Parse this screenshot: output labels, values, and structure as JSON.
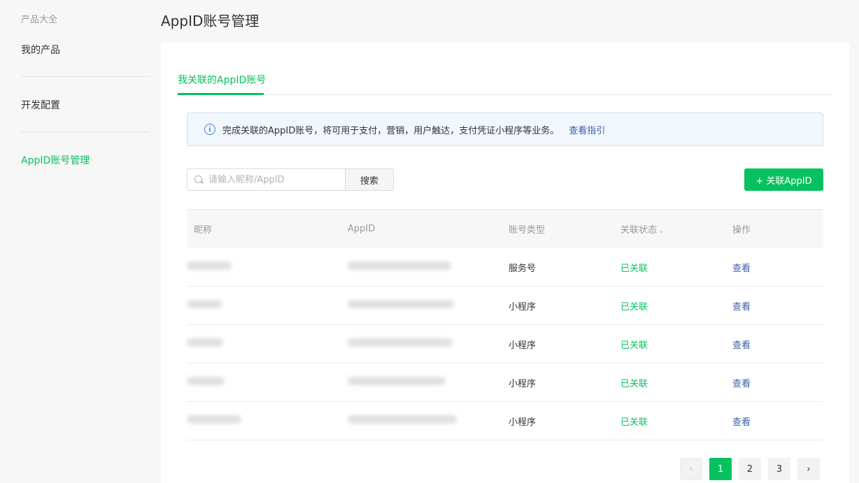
{
  "sidebar": {
    "heading": "产品大全",
    "items": [
      {
        "label": "我的产品"
      },
      {
        "label": "开发配置"
      },
      {
        "label": "AppID账号管理"
      }
    ]
  },
  "page": {
    "title": "AppID账号管理"
  },
  "tabs": [
    {
      "label": "我关联的AppID账号"
    }
  ],
  "notice": {
    "text": "完成关联的AppID账号，将可用于支付，营销，用户触达，支付凭证小程序等业务。",
    "link": "查看指引"
  },
  "search": {
    "placeholder": "请输入昵称/AppID",
    "button": "搜索"
  },
  "add_button": "+ 关联AppID",
  "table": {
    "columns": [
      "昵称",
      "AppID",
      "账号类型",
      "关联状态",
      "操作"
    ],
    "rows": [
      {
        "type": "服务号",
        "status": "已关联",
        "action": "查看"
      },
      {
        "type": "小程序",
        "status": "已关联",
        "action": "查看"
      },
      {
        "type": "小程序",
        "status": "已关联",
        "action": "查看"
      },
      {
        "type": "小程序",
        "status": "已关联",
        "action": "查看"
      },
      {
        "type": "小程序",
        "status": "已关联",
        "action": "查看"
      }
    ]
  },
  "pagination": {
    "prev": "‹",
    "pages": [
      "1",
      "2",
      "3"
    ],
    "next": "›"
  },
  "colors": {
    "accent": "#07c160",
    "link": "#3a5fa7"
  }
}
